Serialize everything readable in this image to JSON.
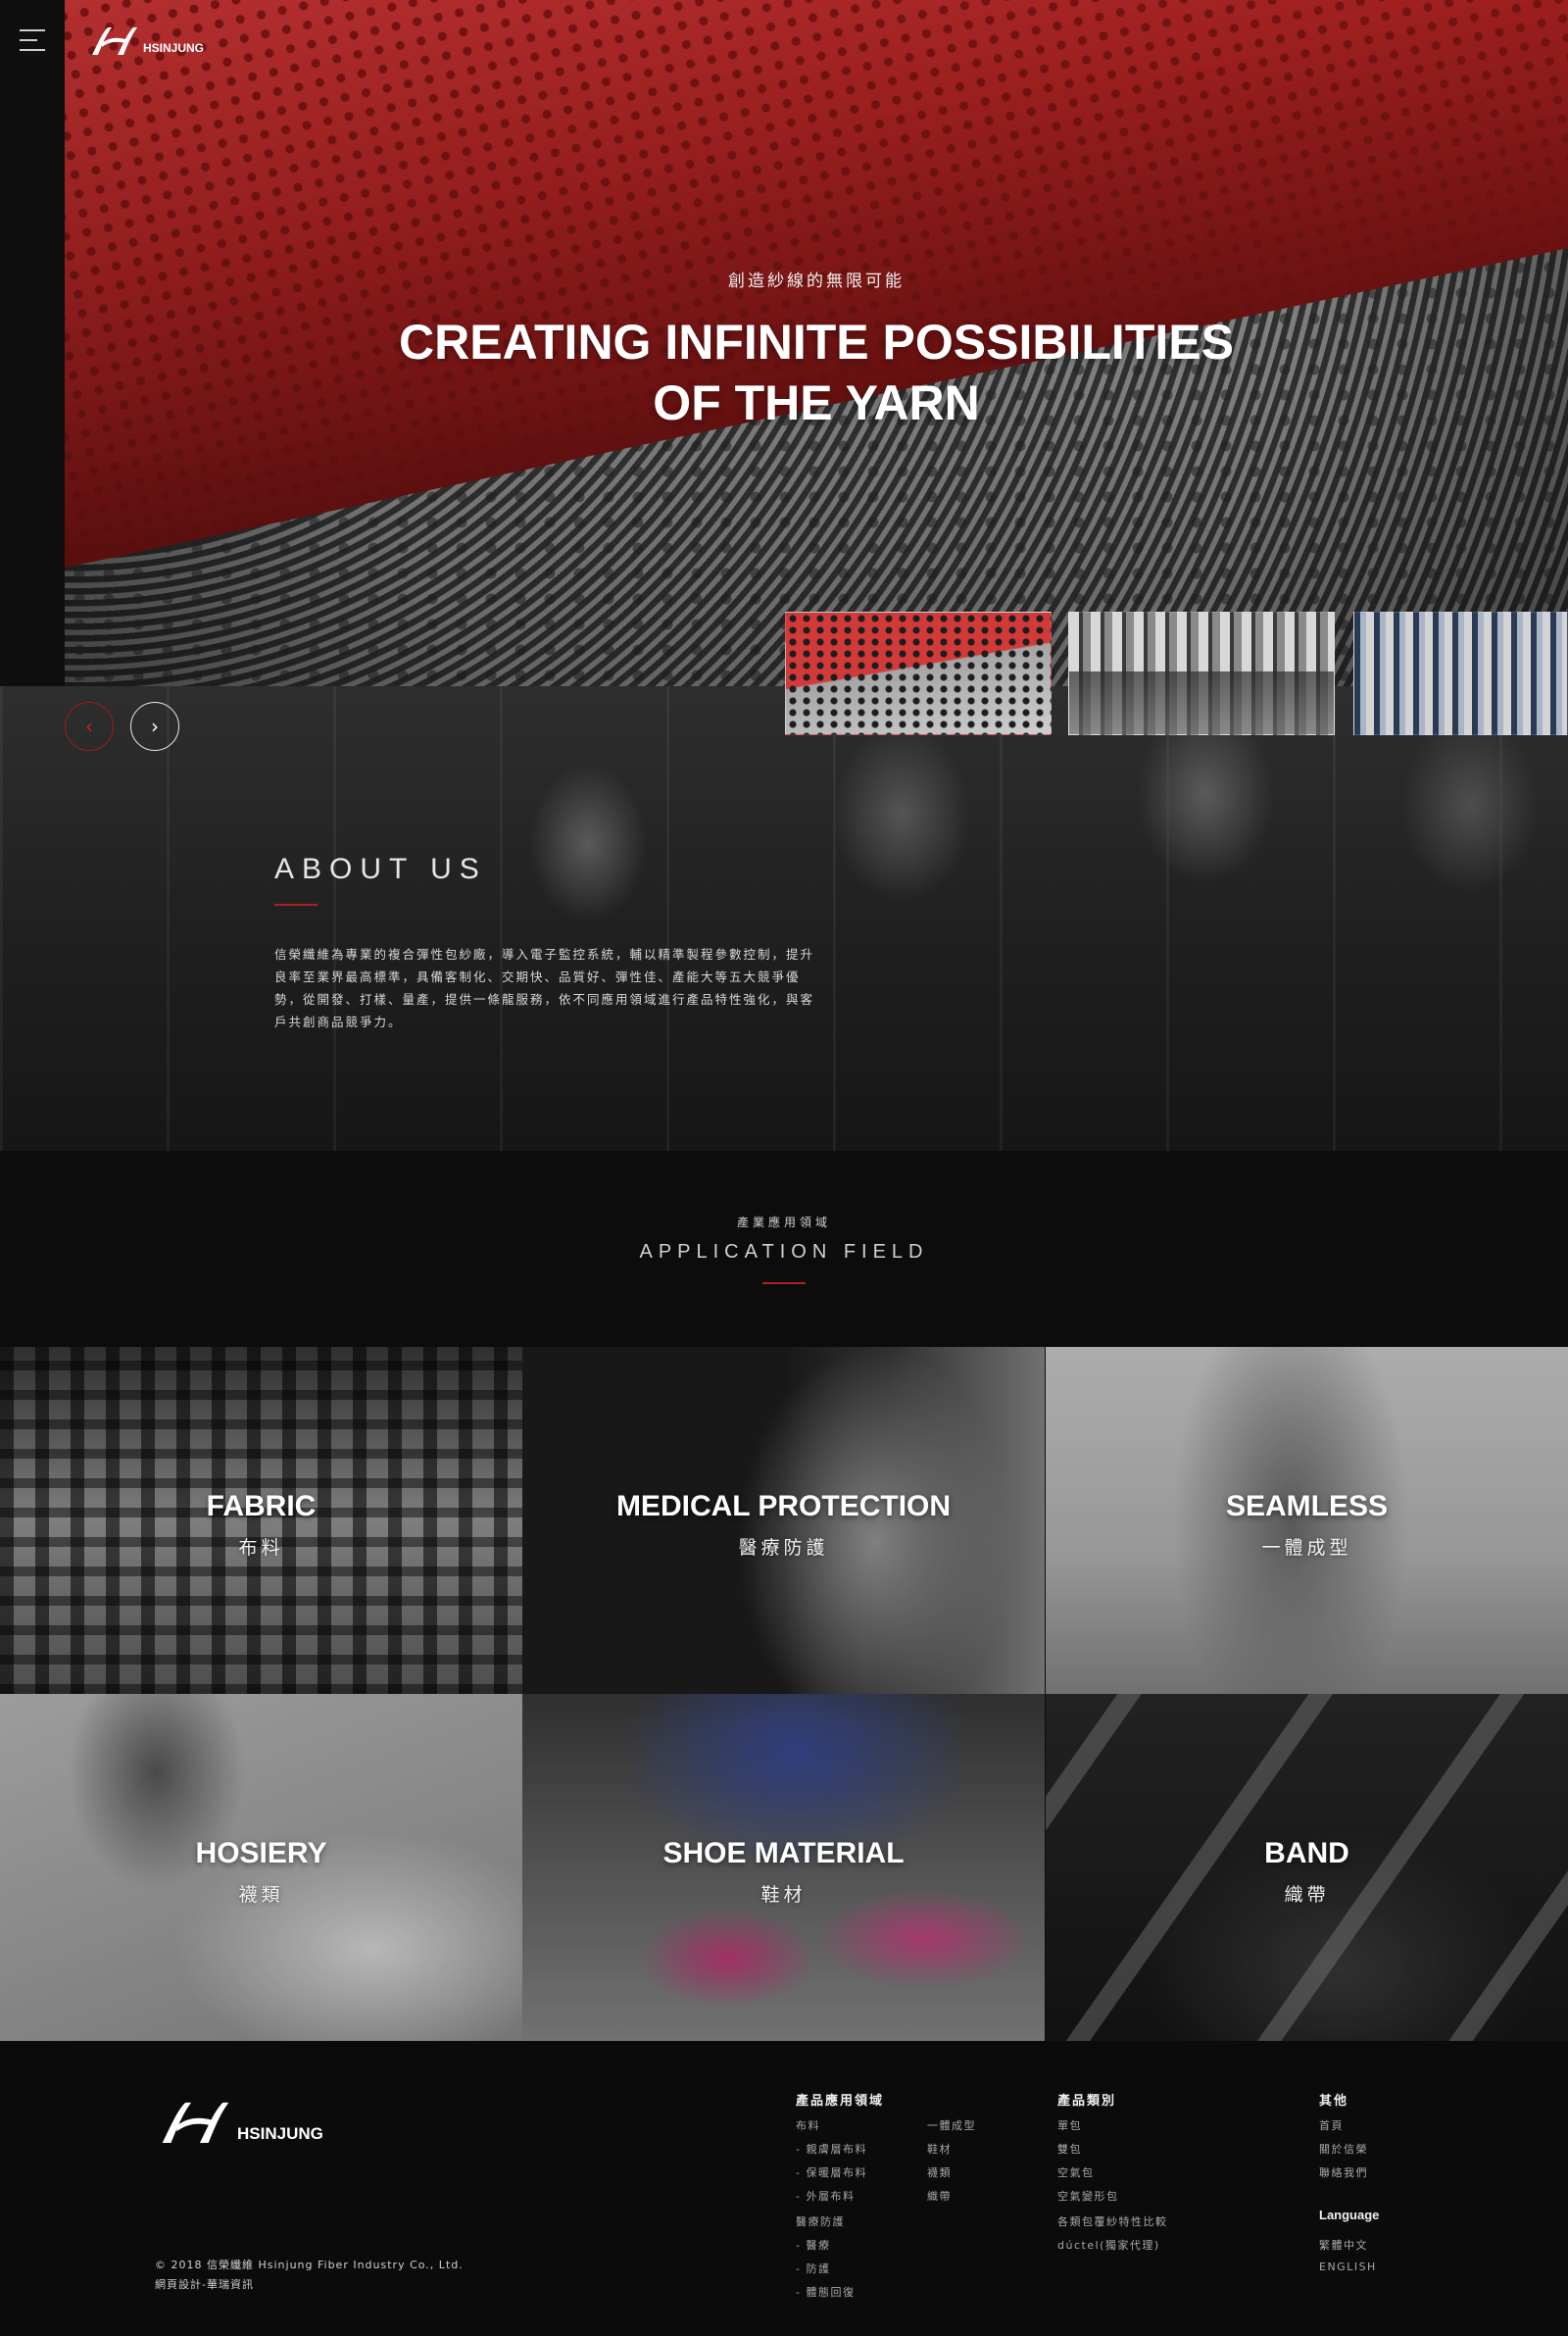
{
  "brand": {
    "logo_text": "HSINJUNG"
  },
  "hero": {
    "subtitle": "創造紗線的無限可能",
    "title_line1": "CREATING INFINITE POSSIBILITIES",
    "title_line2": "OF THE YARN"
  },
  "icons": {
    "menu": "hamburger-menu-icon",
    "prev": "chevron-left-icon",
    "next": "chevron-right-icon"
  },
  "colors": {
    "accent": "#b21f1f",
    "background": "#0d0d0d"
  },
  "about": {
    "title": "ABOUT US",
    "text": "信榮纖維為專業的複合彈性包紗廠，導入電子監控系統，輔以精準製程參數控制，提升良率至業界最高標準，具備客制化、交期快、品質好、彈性佳、產能大等五大競爭優勢，從開發、打樣、量產，提供一條龍服務，依不同應用領域進行產品特性強化，與客戶共創商品競爭力。"
  },
  "application": {
    "subtitle": "產業應用領域",
    "title": "APPLICATION FIELD",
    "tiles": [
      {
        "title": "FABRIC",
        "zh": "布料"
      },
      {
        "title": "MEDICAL PROTECTION",
        "zh": "醫療防護"
      },
      {
        "title": "SEAMLESS",
        "zh": "一體成型"
      },
      {
        "title": "HOSIERY",
        "zh": "襪類"
      },
      {
        "title": "SHOE MATERIAL",
        "zh": "鞋材"
      },
      {
        "title": "BAND",
        "zh": "織帶"
      }
    ]
  },
  "footer": {
    "copyright": "© 2018 信榮纖維 Hsinjung Fiber Industry Co., Ltd.",
    "credit": "網頁設計-華瑞資訊",
    "col1": {
      "title": "產品應用領域",
      "links_a": [
        "布料",
        "- 親膚層布料",
        "- 保暖層布料",
        "- 外層布料",
        "醫療防護",
        "- 醫療",
        "- 防護",
        "- 體態回復"
      ],
      "links_b": [
        "一體成型",
        "鞋材",
        "襪類",
        "織帶"
      ]
    },
    "col2": {
      "title": "產品類別",
      "links": [
        "單包",
        "雙包",
        "空氣包",
        "空氣變形包",
        "各類包覆紗特性比較",
        "dúctel(獨家代理)"
      ]
    },
    "col3": {
      "title": "其他",
      "links": [
        "首頁",
        "關於信榮",
        "聯絡我們"
      ],
      "language_title": "Language",
      "languages": [
        "繁體中文",
        "ENGLISH"
      ]
    }
  }
}
